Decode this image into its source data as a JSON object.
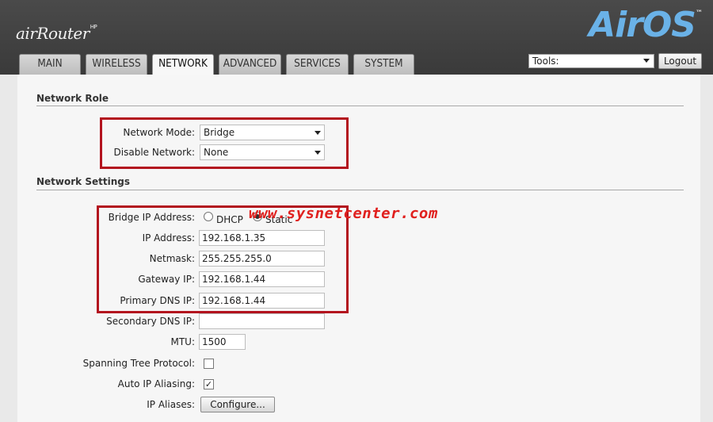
{
  "header": {
    "brand": "airRouter",
    "brand_sup": "HP",
    "logo": "AirOS",
    "logo_tm": "™"
  },
  "tabs": [
    {
      "label": "MAIN",
      "active": false
    },
    {
      "label": "WIRELESS",
      "active": false
    },
    {
      "label": "NETWORK",
      "active": true
    },
    {
      "label": "ADVANCED",
      "active": false
    },
    {
      "label": "SERVICES",
      "active": false
    },
    {
      "label": "SYSTEM",
      "active": false
    }
  ],
  "tools": {
    "value": "Tools:",
    "icon": "chevron-down-icon"
  },
  "logout_label": "Logout",
  "network_role": {
    "title": "Network Role",
    "network_mode": {
      "label": "Network Mode:",
      "value": "Bridge"
    },
    "disable_network": {
      "label": "Disable Network:",
      "value": "None"
    }
  },
  "network_settings": {
    "title": "Network Settings",
    "bridge_ip": {
      "label": "Bridge IP Address:",
      "options": [
        "DHCP",
        "Static"
      ],
      "selected": "Static"
    },
    "ip_address": {
      "label": "IP Address:",
      "value": "192.168.1.35"
    },
    "netmask": {
      "label": "Netmask:",
      "value": "255.255.255.0"
    },
    "gateway": {
      "label": "Gateway IP:",
      "value": "192.168.1.44"
    },
    "primary_dns": {
      "label": "Primary DNS IP:",
      "value": "192.168.1.44"
    },
    "secondary_dns": {
      "label": "Secondary DNS IP:",
      "value": ""
    },
    "mtu": {
      "label": "MTU:",
      "value": "1500"
    },
    "stp": {
      "label": "Spanning Tree Protocol:",
      "checked": false
    },
    "auto_ip": {
      "label": "Auto IP Aliasing:",
      "checked": true,
      "mark": "✓"
    },
    "ip_aliases": {
      "label": "IP Aliases:",
      "button": "Configure..."
    }
  },
  "watermark": "www.sysnetcenter.com",
  "colors": {
    "highlight": "#b3131e",
    "watermark": "#e0201e",
    "logo": "#6ab2e8"
  }
}
